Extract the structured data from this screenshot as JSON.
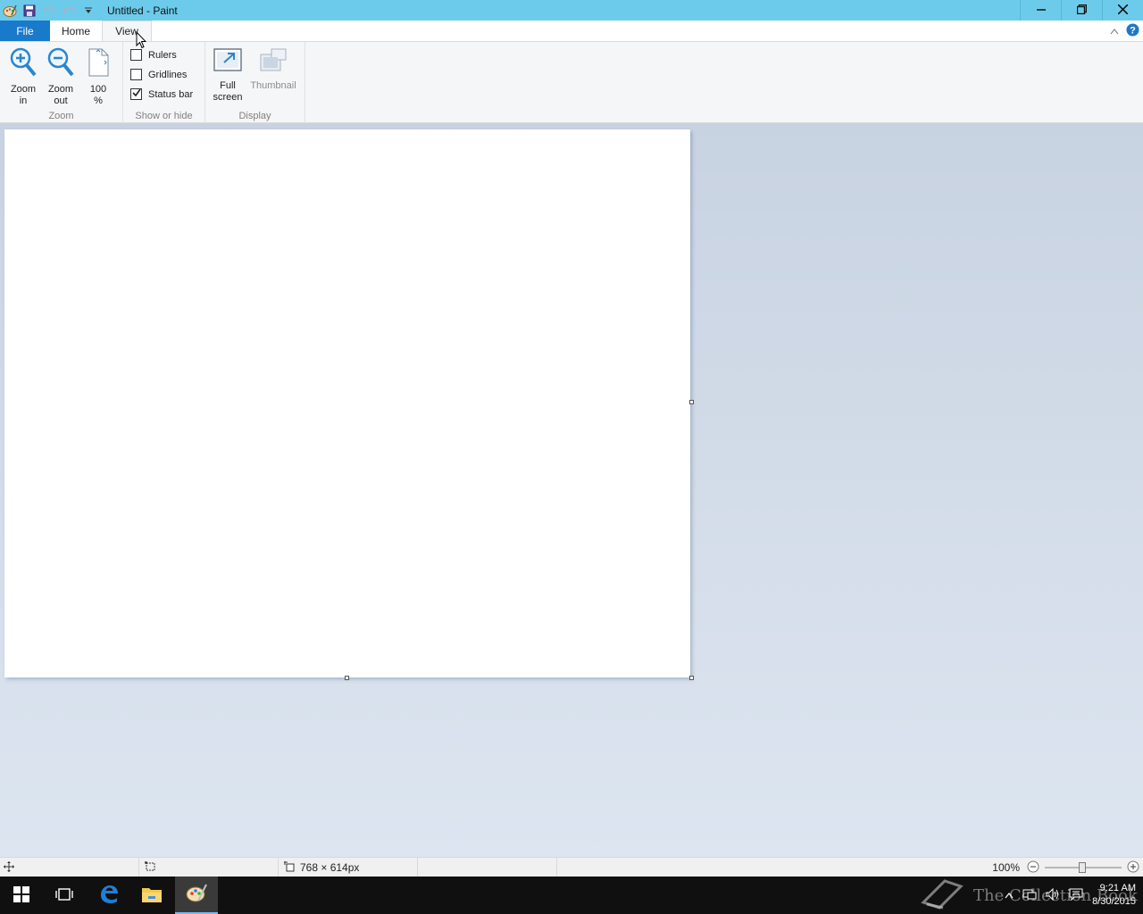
{
  "window": {
    "title": "Untitled - Paint",
    "minimize_icon": "minimize-icon",
    "restore_icon": "restore-icon",
    "close_icon": "close-icon"
  },
  "quick_access": [
    "paint-app-icon",
    "save-icon",
    "undo-icon",
    "redo-icon",
    "customize-dropdown-icon"
  ],
  "tabs": {
    "file": "File",
    "home": "Home",
    "view": "View",
    "active": "View"
  },
  "ribbon": {
    "zoom": {
      "label": "Zoom",
      "zoom_in": "Zoom\nin",
      "zoom_out": "Zoom\nout",
      "actual_size": "100\n%"
    },
    "show_or_hide": {
      "label": "Show or hide",
      "rulers": {
        "label": "Rulers",
        "checked": false
      },
      "gridlines": {
        "label": "Gridlines",
        "checked": false
      },
      "status_bar": {
        "label": "Status bar",
        "checked": true
      }
    },
    "display": {
      "label": "Display",
      "full_screen": "Full\nscreen",
      "thumbnail": "Thumbnail"
    }
  },
  "statusbar": {
    "image_size": "768 × 614px",
    "zoom_level": "100%",
    "zoom_slider_fraction": 0.5
  },
  "taskbar": {
    "time": "9:21 AM",
    "date": "8/30/2015",
    "watermark": "The Collection Book",
    "apps": [
      "start-icon",
      "task-view-icon",
      "edge-icon",
      "file-explorer-icon",
      "paint-icon"
    ]
  },
  "colors": {
    "titlebar": "#6ccbeb",
    "file_tab": "#1979ca",
    "workspace": "#c8d3e2",
    "taskbar": "#101010"
  }
}
